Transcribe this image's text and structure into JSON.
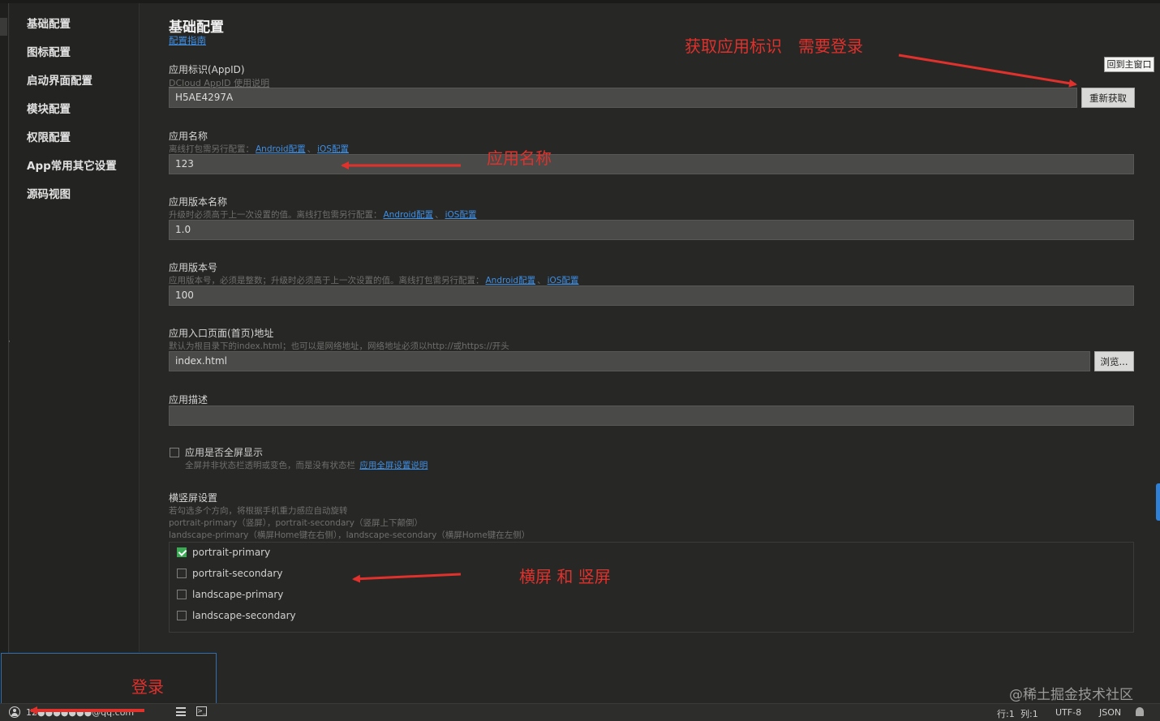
{
  "sidebar": {
    "items": [
      {
        "label": "基础配置"
      },
      {
        "label": "图标配置"
      },
      {
        "label": "启动界面配置"
      },
      {
        "label": "模块配置"
      },
      {
        "label": "权限配置"
      },
      {
        "label": "App常用其它设置"
      },
      {
        "label": "源码视图"
      }
    ]
  },
  "header": {
    "title": "基础配置",
    "guide_link": "配置指南"
  },
  "fields": {
    "appid": {
      "label": "应用标识(AppID)",
      "link": "DCloud AppID 使用说明",
      "value": "H5AE4297A",
      "button": "重新获取"
    },
    "name": {
      "label": "应用名称",
      "hint": "离线打包需另行配置：",
      "link_android": "Android配置",
      "sep": "、",
      "link_ios": "iOS配置",
      "value": "123"
    },
    "version_name": {
      "label": "应用版本名称",
      "hint": "升级时必须高于上一次设置的值。离线打包需另行配置：",
      "link_android": "Android配置",
      "sep": "、",
      "link_ios": "iOS配置",
      "value": "1.0"
    },
    "version_code": {
      "label": "应用版本号",
      "hint": "应用版本号，必须是整数；升级时必须高于上一次设置的值。离线打包需另行配置：",
      "link_android": "Android配置",
      "sep": "、",
      "link_ios": "iOS配置",
      "value": "100"
    },
    "entry": {
      "label": "应用入口页面(首页)地址",
      "hint": "默认为根目录下的index.html；也可以是网络地址，网络地址必须以http://或https://开头",
      "value": "index.html",
      "button": "浏览..."
    },
    "description": {
      "label": "应用描述",
      "value": ""
    },
    "fullscreen": {
      "label": "应用是否全屏显示",
      "hint": "全屏并非状态栏透明或变色，而是没有状态栏",
      "link": "应用全屏设置说明",
      "checked": false
    },
    "orientation": {
      "label": "横竖屏设置",
      "hint1": "若勾选多个方向，将根据手机重力感应自动旋转",
      "hint2": "portrait-primary（竖屏），portrait-secondary（竖屏上下颠倒）",
      "hint3": "landscape-primary（横屏Home键在右侧），landscape-secondary（横屏Home键在左侧）",
      "options": [
        {
          "label": "portrait-primary",
          "checked": true
        },
        {
          "label": "portrait-secondary",
          "checked": false
        },
        {
          "label": "landscape-primary",
          "checked": false
        },
        {
          "label": "landscape-secondary",
          "checked": false
        }
      ]
    }
  },
  "annotations": {
    "appid_note": "获取应用标识　需要登录",
    "name_note": "应用名称",
    "orientation_note": "横屏 和 竖屏",
    "login_note": "登录"
  },
  "popout_button": "回到主窗口",
  "statusbar": {
    "account": "12●●●●●●●@qq.com",
    "line": "行:1",
    "column": "列:1",
    "encoding": "UTF-8",
    "language": "JSON"
  },
  "watermark": "@稀土掘金技术社区",
  "colors": {
    "annotation_red": "#e0312c",
    "link_blue": "#3e8fe6",
    "checkbox_green": "#3aaa55",
    "background": "#272725"
  }
}
